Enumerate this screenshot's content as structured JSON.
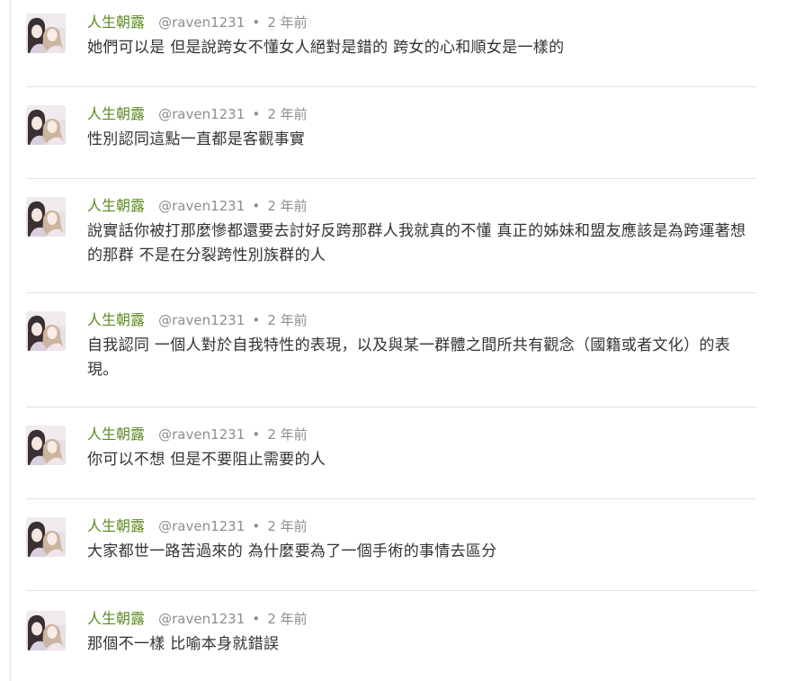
{
  "replies": [
    {
      "author": "人生朝露",
      "handle": "@raven1231",
      "separator": "•",
      "time": "2 年前",
      "text": "她們可以是 但是說跨女不懂女人絕對是錯的 跨女的心和順女是一樣的"
    },
    {
      "author": "人生朝露",
      "handle": "@raven1231",
      "separator": "•",
      "time": "2 年前",
      "text": "性別認同這點一直都是客觀事實"
    },
    {
      "author": "人生朝露",
      "handle": "@raven1231",
      "separator": "•",
      "time": "2 年前",
      "text": "說實話你被打那麼慘都還要去討好反跨那群人我就真的不懂 真正的姊妹和盟友應該是為跨運著想的那群 不是在分裂跨性別族群的人"
    },
    {
      "author": "人生朝露",
      "handle": "@raven1231",
      "separator": "•",
      "time": "2 年前",
      "text": "自我認同 一個人對於自我特性的表現，以及與某一群體之間所共有觀念（國籍或者文化）的表現。"
    },
    {
      "author": "人生朝露",
      "handle": "@raven1231",
      "separator": "•",
      "time": "2 年前",
      "text": "你可以不想 但是不要阻止需要的人"
    },
    {
      "author": "人生朝露",
      "handle": "@raven1231",
      "separator": "•",
      "time": "2 年前",
      "text": "大家都世一路苦過來的 為什麼要為了一個手術的事情去區分"
    },
    {
      "author": "人生朝露",
      "handle": "@raven1231",
      "separator": "•",
      "time": "2 年前",
      "text": "那個不一樣 比喻本身就錯誤"
    }
  ],
  "colors": {
    "author": "#5b8a1e",
    "meta": "#8e8e8e",
    "text": "#333333",
    "divider": "#e3e3e3"
  }
}
